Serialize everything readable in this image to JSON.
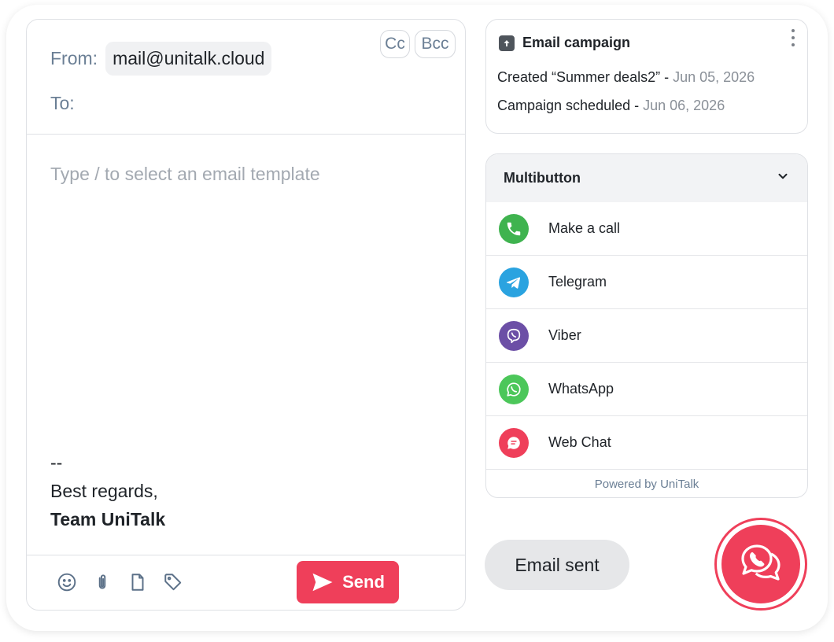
{
  "compose": {
    "from_label": "From:",
    "from_value": "mail@unitalk.cloud",
    "to_label": "To:",
    "cc_label": "Cc",
    "bcc_label": "Bcc",
    "body_placeholder": "Type / to select an email template",
    "signature": {
      "separator": "--",
      "closing": "Best regards,",
      "name": "Team UniTalk"
    },
    "toolbar_icons": [
      "emoji-icon",
      "attachment-icon",
      "document-icon",
      "tag-icon"
    ],
    "send_label": "Send"
  },
  "campaign": {
    "title": "Email campaign",
    "events": [
      {
        "text": "Created “Summer deals2” - ",
        "date": "Jun 05, 2026"
      },
      {
        "text": "Campaign scheduled - ",
        "date": "Jun 06, 2026"
      }
    ]
  },
  "multibutton": {
    "title": "Multibutton",
    "items": [
      {
        "label": "Make a call",
        "icon": "phone-icon",
        "color": "#3fb34f"
      },
      {
        "label": "Telegram",
        "icon": "telegram-icon",
        "color": "#2aa3e0"
      },
      {
        "label": "Viber",
        "icon": "viber-icon",
        "color": "#6c4fa6"
      },
      {
        "label": "WhatsApp",
        "icon": "whatsapp-icon",
        "color": "#4cc75a"
      },
      {
        "label": "Web Chat",
        "icon": "webchat-icon",
        "color": "#ef3f5a"
      }
    ],
    "powered_by": "Powered by UniTalk"
  },
  "status": {
    "email_sent": "Email sent"
  },
  "colors": {
    "accent": "#ef3f5a",
    "muted_text": "#6b7f95"
  }
}
